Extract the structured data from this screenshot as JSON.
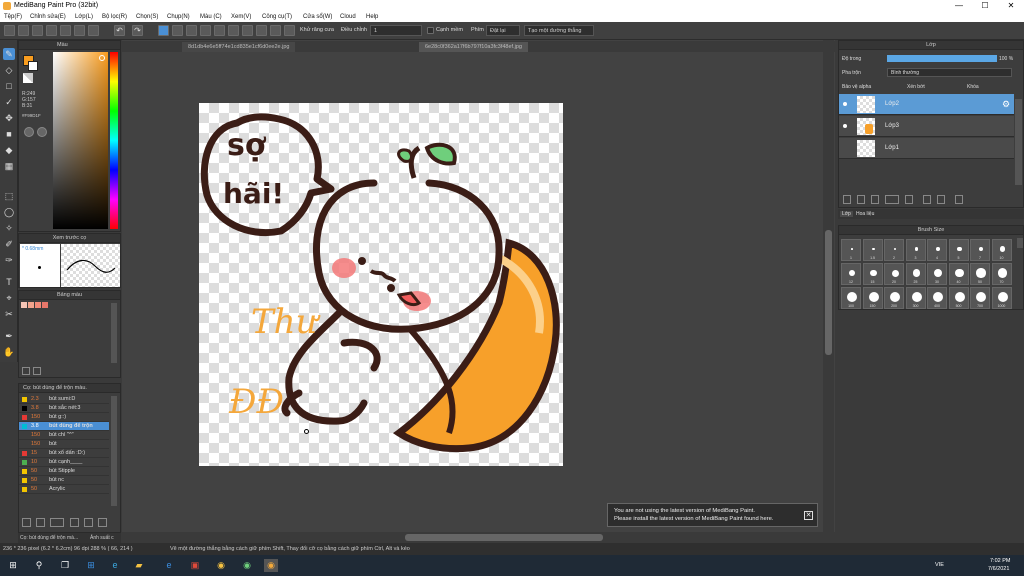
{
  "window": {
    "title": "MediBang Paint Pro (32bit)",
    "minimize": "—",
    "maximize": "☐",
    "close": "✕"
  },
  "menu": [
    "Tệp(F)",
    "Chỉnh sửa(E)",
    "Lớp(L)",
    "Bộ lọc(R)",
    "Chọn(S)",
    "Chụp(N)",
    "Màu (C)",
    "Xem(V)",
    "Công cụ(T)",
    "Cửa sổ(W)",
    "Cloud",
    "Help"
  ],
  "toolbar": {
    "brush_count_label": "Khử răng cưa",
    "adjust_label": "Điều chỉnh",
    "adjust_value": "1",
    "snap_label": "Cạnh mềm",
    "pen_label": "Phím",
    "correction_label": "Đặt lại",
    "straight_label": "Tạo một đường thẳng"
  },
  "tabs": [
    "8d1db4e6e5ff74e1cd835e1cf6d0ee2e.jpg",
    "6e28c0f362a17f6b797f10a3fc3f48ef.jpg"
  ],
  "color_panel": {
    "title": "Màu",
    "r": "R:249",
    "g": "G:157",
    "b": "B:31",
    "hex": "#F99D1F",
    "primary": "#f99d1f",
    "secondary": "#ffffff"
  },
  "brush_preview": {
    "title": "Xem trước cọ",
    "size": "* 0.68mm"
  },
  "palette": {
    "title": "Bảng màu",
    "swatches": [
      "#f7c6b7",
      "#f4a58e",
      "#f38c7a",
      "#e8776a"
    ]
  },
  "brush_list": {
    "title": "Cọ: bút dùng để trộn màu.",
    "items": [
      {
        "size": "2.3",
        "name": "bút sumi:D",
        "color": "#f2c500"
      },
      {
        "size": "3.8",
        "name": "bút sắc nét:3",
        "color": "#000000"
      },
      {
        "size": "150",
        "name": "bút g::)",
        "color": "#e53935"
      },
      {
        "size": "3.8",
        "name": "bút dùng để trộn",
        "color": "#00bcd4",
        "selected": true
      },
      {
        "size": "150",
        "name": "bút chì \"^\"",
        "color": ""
      },
      {
        "size": "150",
        "name": "bút",
        "color": ""
      },
      {
        "size": "15",
        "name": "bút xổ dấn :D:)",
        "color": "#e53935"
      },
      {
        "size": "10",
        "name": "bút cạnh____",
        "color": "#4caf50"
      },
      {
        "size": "50",
        "name": "bút Stipple",
        "color": "#f2c500"
      },
      {
        "size": "50",
        "name": "bút nc",
        "color": "#f2c500"
      },
      {
        "size": "50",
        "name": "Acrylic",
        "color": "#f2c500"
      }
    ]
  },
  "bottom_tabs": [
    "Cọ: bút dùng để trộn mà...",
    "Ảnh suất c"
  ],
  "layers_panel": {
    "title": "Lớp",
    "opacity_label": "Độ trong",
    "opacity_value": "100 %",
    "blend_label": "Pha trộn",
    "blend_value": "Bình thường",
    "protect_alpha": "Bảo vệ alpha",
    "clipping": "Xén bớt",
    "lock": "Khóa",
    "layers": [
      {
        "name": "Lớp2",
        "selected": true
      },
      {
        "name": "Lớp3",
        "selected": false
      },
      {
        "name": "Lớp1",
        "selected": false
      }
    ],
    "tab_layer": "Lớp",
    "tab_history": "Hoa liệu"
  },
  "brush_size": {
    "title": "Brush Size",
    "sizes": [
      "1",
      "1.5",
      "2",
      "3",
      "4",
      "5",
      "7",
      "10",
      "12",
      "15",
      "20",
      "25",
      "30",
      "40",
      "50",
      "70",
      "100",
      "150",
      "200",
      "300",
      "400",
      "500",
      "700",
      "1000"
    ]
  },
  "notice": {
    "line1": "You are not using the latest version of MediBang Paint.",
    "line2": "Please install the latest version of MediBang Paint found here."
  },
  "status": {
    "size": "236 * 236 pixel  (6.2 * 6.2cm)  96 dpi  288 %  ( 66, 214 )",
    "hint": "Vẽ một đường thẳng bằng cách giữ phím Shift, Thay đổi cỡ cọ bằng cách giữ phím Ctrl, Alt và kéo"
  },
  "taskbar": {
    "time": "7:02 PM",
    "date": "7/6/2021",
    "lang": "VIE"
  },
  "artwork": {
    "bubble_text_1": "sợ",
    "bubble_text_2": "hãi!",
    "signature_1": "Thư",
    "signature_2": "ĐĐ"
  }
}
